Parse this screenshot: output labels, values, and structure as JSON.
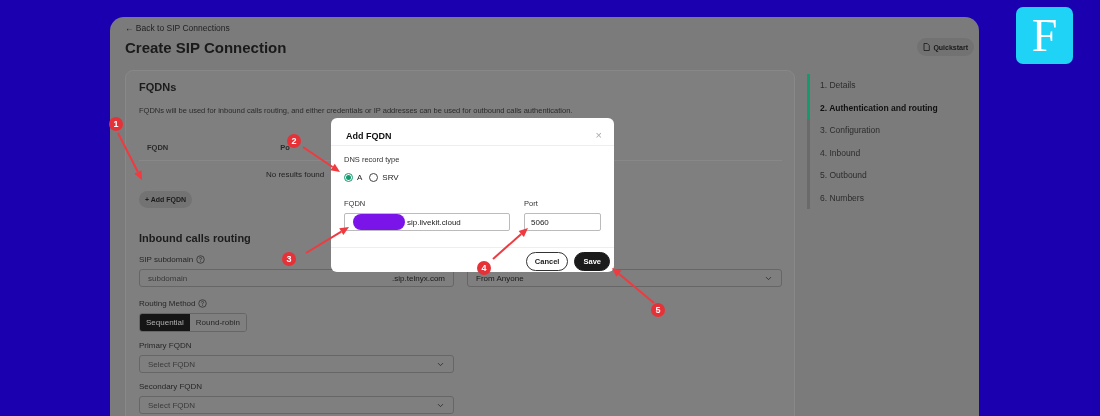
{
  "logo": {
    "letter": "F"
  },
  "header": {
    "back_link": "← Back to SIP Connections",
    "title": "Create SIP Connection",
    "quickstart_button": "Quickstart"
  },
  "fqdns": {
    "heading": "FQDNs",
    "description": "FQDNs will be used for inbound calls routing, and either credentials or IP addresses can be used for outbound calls authentication.",
    "columns": [
      "FQDN",
      "Po"
    ],
    "empty_text": "No results found",
    "add_button": "+ Add FQDN"
  },
  "inbound": {
    "heading": "Inbound calls routing",
    "sip_subdomain": {
      "label": "SIP subdomain",
      "placeholder": "subdomain",
      "suffix": ".sip.telnyx.com"
    },
    "from_select": {
      "value": "From Anyone"
    },
    "routing_method": {
      "label": "Routing Method",
      "options": [
        {
          "label": "Sequential",
          "selected": true
        },
        {
          "label": "Round-robin",
          "selected": false
        }
      ]
    },
    "primary_fqdn": {
      "label": "Primary FQDN",
      "placeholder": "Select FQDN"
    },
    "secondary_fqdn": {
      "label": "Secondary FQDN",
      "placeholder": "Select FQDN"
    }
  },
  "steps": [
    {
      "label": "1. Details",
      "selected": false,
      "done": true
    },
    {
      "label": "2. Authentication and routing",
      "selected": true,
      "done": true
    },
    {
      "label": "3. Configuration",
      "selected": false,
      "done": false
    },
    {
      "label": "4. Inbound",
      "selected": false,
      "done": false
    },
    {
      "label": "5. Outbound",
      "selected": false,
      "done": false
    },
    {
      "label": "6. Numbers",
      "selected": false,
      "done": false
    }
  ],
  "modal": {
    "title": "Add FQDN",
    "close": "×",
    "dns_record_type": {
      "label": "DNS record type",
      "options": [
        {
          "label": "A",
          "selected": true
        },
        {
          "label": "SRV",
          "selected": false
        }
      ]
    },
    "fqdn": {
      "label": "FQDN",
      "value": "sip.livekit.cloud",
      "redacted": true
    },
    "port": {
      "label": "Port",
      "value": "5060"
    },
    "buttons": [
      {
        "label": "Cancel",
        "kind": "secondary"
      },
      {
        "label": "Save",
        "kind": "primary"
      }
    ]
  },
  "annotations": [
    {
      "number": "1"
    },
    {
      "number": "2"
    },
    {
      "number": "3"
    },
    {
      "number": "4"
    },
    {
      "number": "5"
    }
  ]
}
